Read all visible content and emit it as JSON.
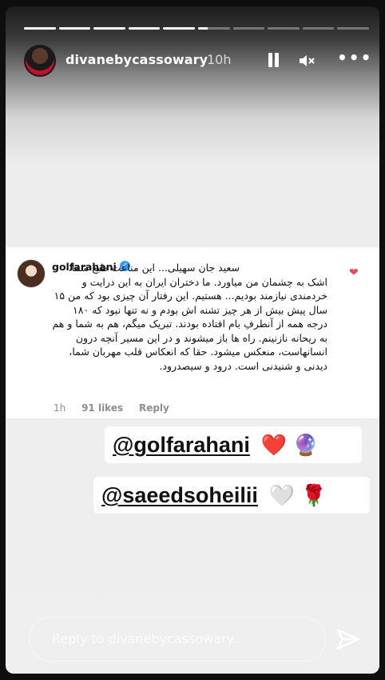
{
  "story": {
    "segments_total": 10,
    "segments_viewed": 5,
    "current_progress": 0.3
  },
  "header": {
    "username": "divanebycassowary",
    "time": "10h",
    "icons": [
      "pause-icon",
      "mute-icon",
      "more-icon"
    ]
  },
  "comment": {
    "username": "golfarahani",
    "text": "سعید جان سهیلی... این مناعت طبع شما، اشک به چشمان من میاورد. ما دختران ایران به این درایت و خردمندی نیازمند بودیم... هستیم. این رفتار آن چیزی بود که من ۱۵ سال پیش بیش از هر چیز تشنه اش بودم و نه تنها نبود که ۱۸۰ درجه همه از آنطرفِ بام افتاده بودند. تبریک میگم، هم به شما و هم به ریحانه نازنینم. راه ها باز میشوند و در این مسیر آنچه درون انسانهاست، منعکس میشود. حقا که انعکاس قلب مهربان شما، دیدنی و شنیدنی است. درود و سیصدرود.",
    "age": "1h",
    "likes": "91 likes",
    "reply_label": "Reply"
  },
  "tags": [
    {
      "handle": "@golfarahani",
      "emojis": "❤️ 🔮"
    },
    {
      "handle": "@saeedsoheilii",
      "emojis": "🤍 🌹"
    }
  ],
  "reply_box": {
    "placeholder": "Reply to divanebycassowary..."
  },
  "colors": {
    "verified": "#3897f0",
    "heart": "#ed4956"
  }
}
